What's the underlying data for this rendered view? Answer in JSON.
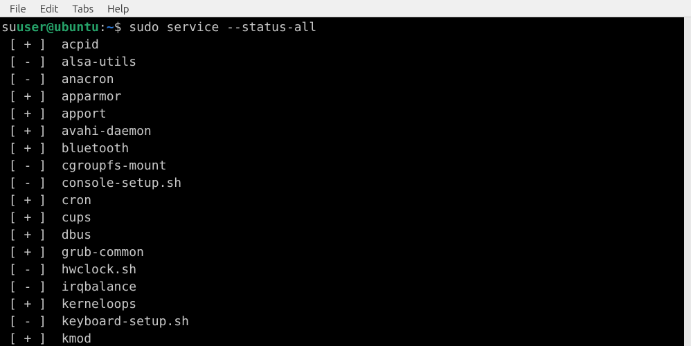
{
  "menubar": {
    "items": [
      "File",
      "Edit",
      "Tabs",
      "Help"
    ]
  },
  "prompt": {
    "prefix": "su",
    "userhost": "user@ubuntu",
    "colon": ":",
    "path": "~",
    "dollar": "$",
    "command": "sudo service --status-all"
  },
  "services": [
    {
      "status": "+",
      "name": "acpid"
    },
    {
      "status": "-",
      "name": "alsa-utils"
    },
    {
      "status": "-",
      "name": "anacron"
    },
    {
      "status": "+",
      "name": "apparmor"
    },
    {
      "status": "+",
      "name": "apport"
    },
    {
      "status": "+",
      "name": "avahi-daemon"
    },
    {
      "status": "+",
      "name": "bluetooth"
    },
    {
      "status": "-",
      "name": "cgroupfs-mount"
    },
    {
      "status": "-",
      "name": "console-setup.sh"
    },
    {
      "status": "+",
      "name": "cron"
    },
    {
      "status": "+",
      "name": "cups"
    },
    {
      "status": "+",
      "name": "dbus"
    },
    {
      "status": "+",
      "name": "grub-common"
    },
    {
      "status": "-",
      "name": "hwclock.sh"
    },
    {
      "status": "-",
      "name": "irqbalance"
    },
    {
      "status": "+",
      "name": "kerneloops"
    },
    {
      "status": "-",
      "name": "keyboard-setup.sh"
    },
    {
      "status": "+",
      "name": "kmod"
    }
  ]
}
